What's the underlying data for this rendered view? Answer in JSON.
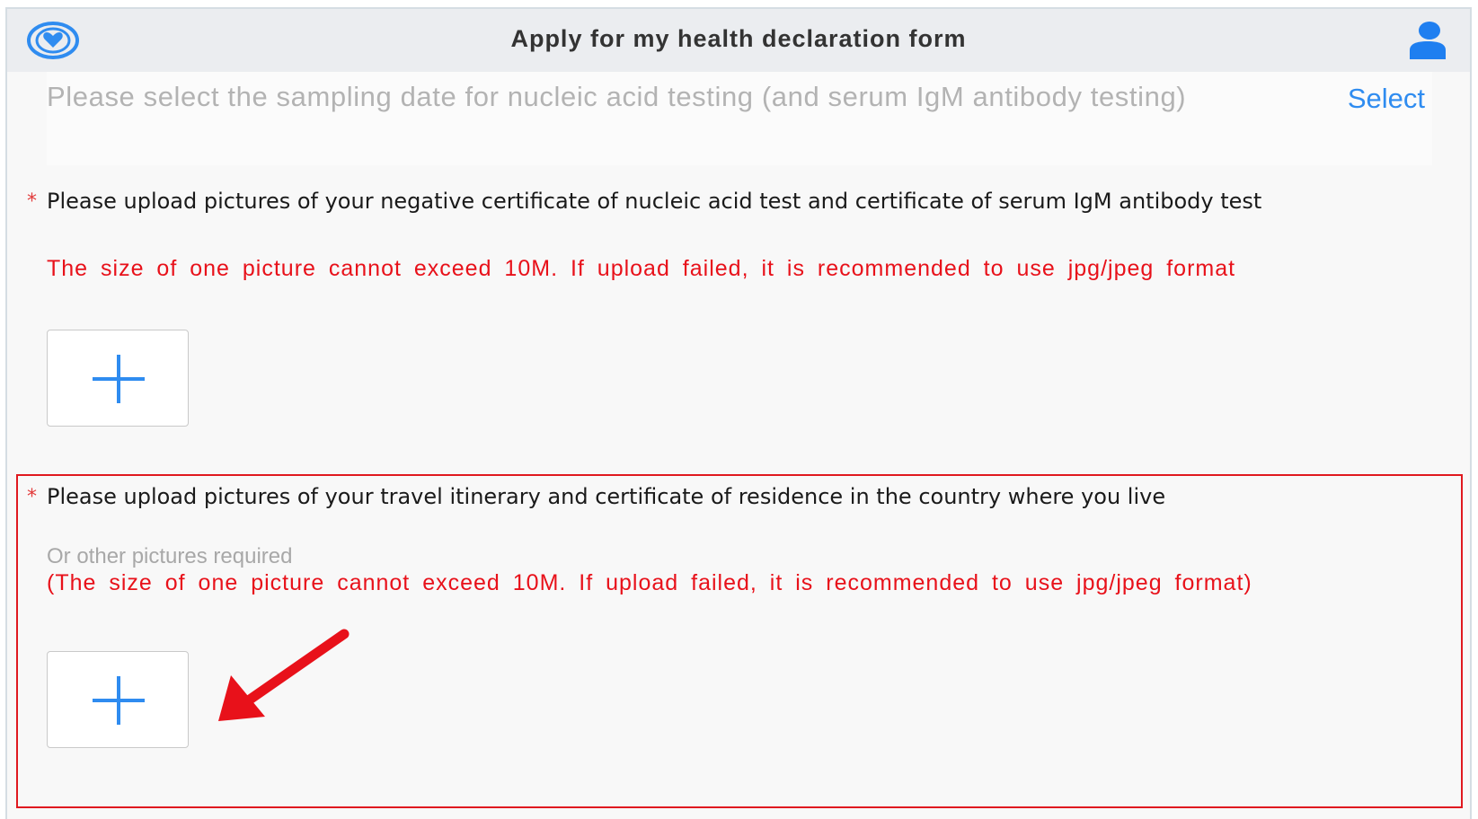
{
  "header": {
    "title": "Apply for my health declaration form",
    "logo_icon": "heart-shield-logo-icon",
    "user_icon": "user-icon"
  },
  "date_field": {
    "placeholder": "Please select the sampling date for nucleic acid testing (and serum IgM antibody testing)",
    "action_label": "Select"
  },
  "sections": [
    {
      "required_mark": "*",
      "question": "Please upload pictures of your negative certificate of nucleic acid test and certificate of serum IgM antibody test",
      "hint": "The size of one picture cannot exceed 10M. If upload failed, it is recommended to use jpg/jpeg format",
      "upload_icon": "plus-icon"
    },
    {
      "required_mark": "*",
      "question": "Please upload pictures of your travel itinerary and certificate of residence in the country where you live",
      "sub_hint": "Or other pictures required",
      "hint": "(The size of one picture cannot exceed 10M. If upload failed, it is recommended to use jpg/jpeg format)",
      "upload_icon": "plus-icon"
    }
  ],
  "colors": {
    "accent": "#2f8cf0",
    "warning": "#e8111a",
    "annotation": "#e0191f",
    "header_bg": "#ebedf0"
  }
}
